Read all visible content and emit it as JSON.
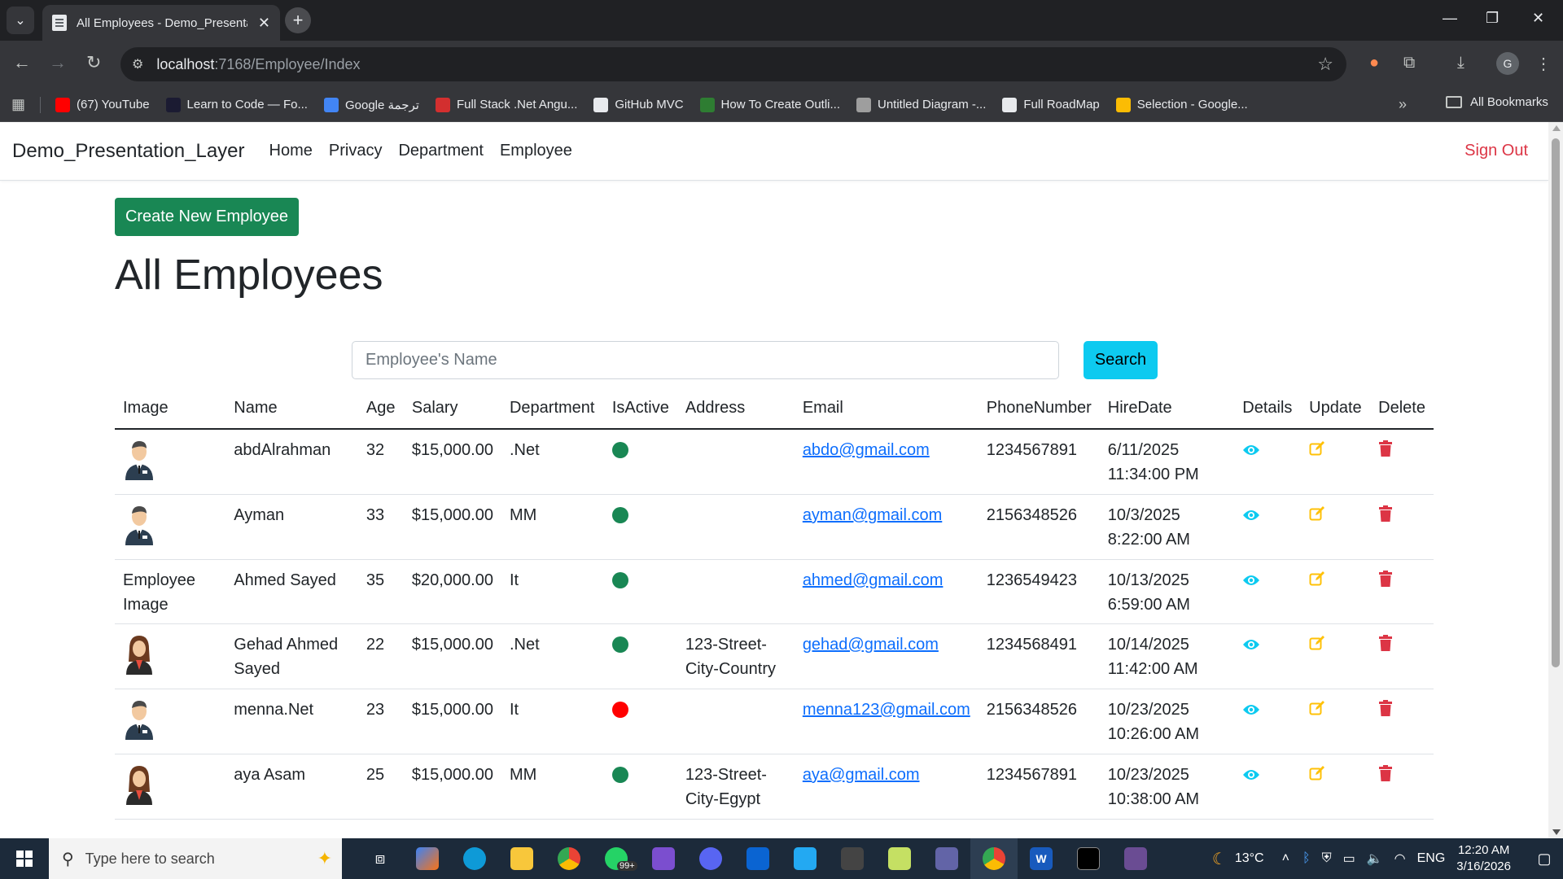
{
  "browser": {
    "tab_title": "All Employees - Demo_Presentati",
    "url_host": "localhost",
    "url_path": ":7168/Employee/Index",
    "bookmarks": [
      {
        "label": "(67) YouTube",
        "icon": "youtube-icon",
        "color": "#ff0000"
      },
      {
        "label": "Learn to Code — Fo...",
        "icon": "code-icon",
        "color": "#1b1b32"
      },
      {
        "label": "Google ترجمة",
        "icon": "translate-icon",
        "color": "#4285f4"
      },
      {
        "label": "Full Stack .Net Angu...",
        "icon": "pdf-icon",
        "color": "#d32f2f"
      },
      {
        "label": "GitHub MVC",
        "icon": "github-icon",
        "color": "#e8eaed"
      },
      {
        "label": "How To Create Outli...",
        "icon": "wiki-icon",
        "color": "#2e7d32"
      },
      {
        "label": "Untitled Diagram -...",
        "icon": "diagram-icon",
        "color": "#9e9e9e"
      },
      {
        "label": "Full RoadMap",
        "icon": "notion-icon",
        "color": "#e8eaed"
      },
      {
        "label": "Selection - Google...",
        "icon": "sheets-icon",
        "color": "#fbbc04"
      }
    ],
    "all_bookmarks": "All Bookmarks",
    "profile_initial": "G"
  },
  "navbar": {
    "brand": "Demo_Presentation_Layer",
    "links": [
      "Home",
      "Privacy",
      "Department",
      "Employee"
    ],
    "signout": "Sign Out"
  },
  "page": {
    "create_label": "Create New Employee",
    "title": "All Employees",
    "search_placeholder": "Employee's Name",
    "search_label": "Search"
  },
  "table": {
    "headers": [
      "Image",
      "Name",
      "Age",
      "Salary",
      "Department",
      "IsActive",
      "Address",
      "Email",
      "PhoneNumber",
      "HireDate",
      "Details",
      "Update",
      "Delete"
    ],
    "rows": [
      {
        "image": "male",
        "name": "abdAlrahman",
        "age": "32",
        "salary": "$15,000.00",
        "department": ".Net",
        "active": true,
        "address": "",
        "email": "abdo@gmail.com",
        "phone": "1234567891",
        "hire_date": "6/11/2025",
        "hire_time": "11:34:00 PM"
      },
      {
        "image": "male",
        "name": "Ayman",
        "age": "33",
        "salary": "$15,000.00",
        "department": "MM",
        "active": true,
        "address": "",
        "email": "ayman@gmail.com",
        "phone": "2156348526",
        "hire_date": "10/3/2025",
        "hire_time": "8:22:00 AM"
      },
      {
        "image": "broken",
        "image_alt": "Employee Image",
        "name": "Ahmed Sayed",
        "age": "35",
        "salary": "$20,000.00",
        "department": "It",
        "active": true,
        "address": "",
        "email": "ahmed@gmail.com",
        "phone": "1236549423",
        "hire_date": "10/13/2025",
        "hire_time": "6:59:00 AM"
      },
      {
        "image": "female",
        "name": "Gehad Ahmed Sayed",
        "age": "22",
        "salary": "$15,000.00",
        "department": ".Net",
        "active": true,
        "address": "123-Street-City-Country",
        "email": "gehad@gmail.com",
        "phone": "1234568491",
        "hire_date": "10/14/2025",
        "hire_time": "11:42:00 AM"
      },
      {
        "image": "male",
        "name": "menna.Net",
        "age": "23",
        "salary": "$15,000.00",
        "department": "It",
        "active": false,
        "address": "",
        "email": "menna123@gmail.com",
        "phone": "2156348526",
        "hire_date": "10/23/2025",
        "hire_time": "10:26:00 AM"
      },
      {
        "image": "female",
        "name": "aya Asam",
        "age": "25",
        "salary": "$15,000.00",
        "department": "MM",
        "active": true,
        "address": "123-Street-City-Egypt",
        "email": "aya@gmail.com",
        "phone": "1234567891",
        "hire_date": "10/23/2025",
        "hire_time": "10:38:00 AM"
      }
    ]
  },
  "colors": {
    "active": "#198754",
    "inactive": "#ff0000",
    "details": "#0dcaf0",
    "update": "#ffc107",
    "delete": "#dc3545"
  },
  "taskbar": {
    "search_placeholder": "Type here to search",
    "badge": "99+",
    "weather": "13°C",
    "lang": "ENG",
    "time": "12:20 AM",
    "date": "3/16/2026"
  }
}
